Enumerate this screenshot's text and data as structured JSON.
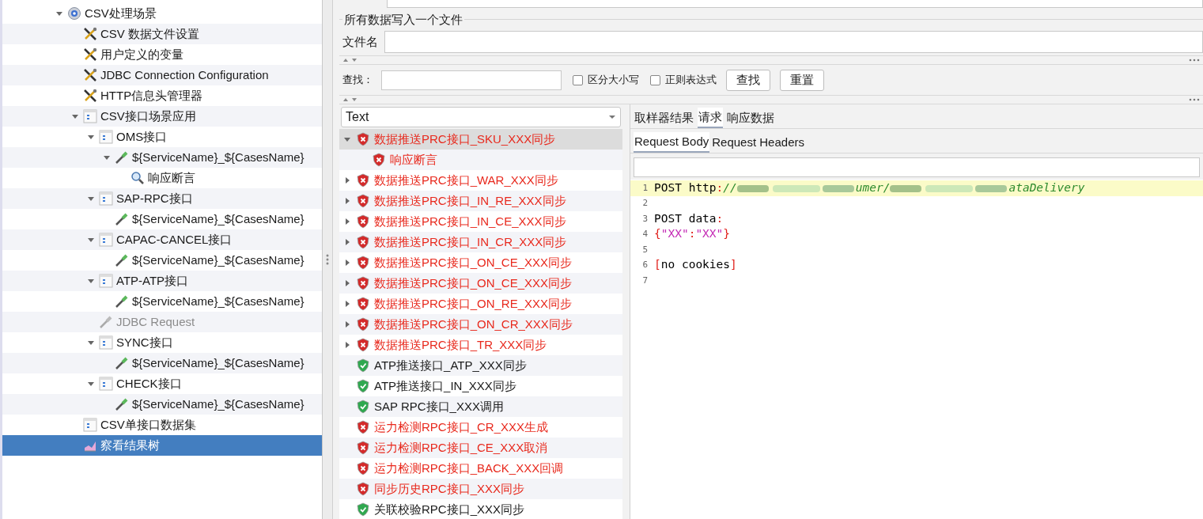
{
  "tree": [
    {
      "label": "CSV处理场景",
      "kind": "gear",
      "expanded": true,
      "selected": false,
      "disabled": false,
      "children": [
        {
          "label": "CSV 数据文件设置",
          "kind": "tool",
          "selected": false,
          "disabled": false
        },
        {
          "label": "用户定义的变量",
          "kind": "tool",
          "selected": false,
          "disabled": false
        },
        {
          "label": "JDBC Connection Configuration",
          "kind": "tool",
          "selected": false,
          "disabled": false
        },
        {
          "label": "HTTP信息头管理器",
          "kind": "tool",
          "selected": false,
          "disabled": false
        },
        {
          "label": "CSV接口场景应用",
          "kind": "controller",
          "expanded": true,
          "selected": false,
          "disabled": false,
          "children": [
            {
              "label": "OMS接口",
              "kind": "controller",
              "expanded": true,
              "selected": false,
              "disabled": false,
              "children": [
                {
                  "label": "${ServiceName}_${CasesName}",
                  "kind": "sampler",
                  "expanded": true,
                  "selected": false,
                  "disabled": false,
                  "children": [
                    {
                      "label": "响应断言",
                      "kind": "assertion",
                      "selected": false,
                      "disabled": false
                    }
                  ]
                }
              ]
            },
            {
              "label": "SAP-RPC接口",
              "kind": "controller",
              "expanded": true,
              "selected": false,
              "disabled": false,
              "children": [
                {
                  "label": "${ServiceName}_${CasesName}",
                  "kind": "sampler",
                  "selected": false,
                  "disabled": false
                }
              ]
            },
            {
              "label": "CAPAC-CANCEL接口",
              "kind": "controller",
              "expanded": true,
              "selected": false,
              "disabled": false,
              "children": [
                {
                  "label": "${ServiceName}_${CasesName}",
                  "kind": "sampler",
                  "selected": false,
                  "disabled": false
                }
              ]
            },
            {
              "label": "ATP-ATP接口",
              "kind": "controller",
              "expanded": true,
              "selected": false,
              "disabled": false,
              "children": [
                {
                  "label": "${ServiceName}_${CasesName}",
                  "kind": "sampler",
                  "selected": false,
                  "disabled": false
                }
              ]
            },
            {
              "label": "JDBC Request",
              "kind": "sampler",
              "selected": false,
              "disabled": true
            },
            {
              "label": "SYNC接口",
              "kind": "controller",
              "expanded": true,
              "selected": false,
              "disabled": false,
              "children": [
                {
                  "label": "${ServiceName}_${CasesName}",
                  "kind": "sampler",
                  "selected": false,
                  "disabled": false
                }
              ]
            },
            {
              "label": "CHECK接口",
              "kind": "controller",
              "expanded": true,
              "selected": false,
              "disabled": false,
              "children": [
                {
                  "label": "${ServiceName}_${CasesName}",
                  "kind": "sampler",
                  "selected": false,
                  "disabled": false
                }
              ]
            }
          ]
        },
        {
          "label": "CSV单接口数据集",
          "kind": "controller",
          "selected": false,
          "disabled": false
        },
        {
          "label": "察看结果树",
          "kind": "listener",
          "selected": true,
          "disabled": false
        }
      ]
    }
  ],
  "file_group": {
    "legend": "所有数据写入一个文件",
    "filename_label": "文件名"
  },
  "search": {
    "label": "查找：",
    "options": [
      {
        "label": "区分大小写",
        "checked": false
      },
      {
        "label": "正则表达式",
        "checked": false
      }
    ],
    "buttons": [
      "查找",
      "重置"
    ]
  },
  "renderer": {
    "value": "Text"
  },
  "results": [
    {
      "label": "数据推送PRC接口_SKU_XXX同步",
      "passed": false,
      "expanded": true,
      "selected": true,
      "children": [
        {
          "label": "响应断言",
          "passed": false,
          "selected": false
        }
      ]
    },
    {
      "label": "数据推送PRC接口_WAR_XXX同步",
      "passed": false,
      "expanded": false,
      "selected": false
    },
    {
      "label": "数据推送PRC接口_IN_RE_XXX同步",
      "passed": false,
      "expanded": false,
      "selected": false
    },
    {
      "label": "数据推送PRC接口_IN_CE_XXX同步",
      "passed": false,
      "expanded": false,
      "selected": false
    },
    {
      "label": "数据推送PRC接口_IN_CR_XXX同步",
      "passed": false,
      "expanded": false,
      "selected": false
    },
    {
      "label": "数据推送PRC接口_ON_CE_XXX同步",
      "passed": false,
      "expanded": false,
      "selected": false
    },
    {
      "label": "数据推送PRC接口_ON_CE_XXX同步",
      "passed": false,
      "expanded": false,
      "selected": false
    },
    {
      "label": "数据推送PRC接口_ON_RE_XXX同步",
      "passed": false,
      "expanded": false,
      "selected": false
    },
    {
      "label": "数据推送PRC接口_ON_CR_XXX同步",
      "passed": false,
      "expanded": false,
      "selected": false
    },
    {
      "label": "数据推送PRC接口_TR_XXX同步",
      "passed": false,
      "expanded": false,
      "selected": false
    },
    {
      "label": "ATP推送接口_ATP_XXX同步",
      "passed": true,
      "selected": false
    },
    {
      "label": "ATP推送接口_IN_XXX同步",
      "passed": true,
      "selected": false
    },
    {
      "label": "SAP RPC接口_XXX调用",
      "passed": true,
      "selected": false
    },
    {
      "label": "运力检测RPC接口_CR_XXX生成",
      "passed": false,
      "selected": false
    },
    {
      "label": "运力检测RPC接口_CE_XXX取消",
      "passed": false,
      "selected": false
    },
    {
      "label": "运力检测RPC接口_BACK_XXX回调",
      "passed": false,
      "selected": false
    },
    {
      "label": "同步历史RPC接口_XXX同步",
      "passed": false,
      "selected": false
    },
    {
      "label": "关联校验RPC接口_XXX同步",
      "passed": true,
      "selected": false
    }
  ],
  "tabs": [
    {
      "label": "取样器结果",
      "selected": false
    },
    {
      "label": "请求",
      "selected": true
    },
    {
      "label": "响应数据",
      "selected": false
    }
  ],
  "subtabs": [
    {
      "label": "Request Body",
      "selected": true
    },
    {
      "label": "Request Headers",
      "selected": false
    }
  ],
  "code": [
    {
      "number": "1",
      "highlighted": true,
      "tokens": [
        {
          "text": "POST http",
          "kind": "plain"
        },
        {
          "text": ":",
          "kind": "punct"
        },
        {
          "text": "//",
          "kind": "url"
        },
        {
          "kind": "blur"
        },
        {
          "text": "umer/",
          "kind": "url"
        },
        {
          "kind": "blur"
        },
        {
          "text": "ataDelivery",
          "kind": "url"
        }
      ]
    },
    {
      "number": "2",
      "highlighted": false
    },
    {
      "number": "3",
      "highlighted": false,
      "tokens": [
        {
          "text": "POST data",
          "kind": "plain"
        },
        {
          "text": ":",
          "kind": "punct"
        }
      ]
    },
    {
      "number": "4",
      "highlighted": false,
      "tokens": [
        {
          "text": "{",
          "kind": "punct"
        },
        {
          "text": "\"XX\"",
          "kind": "string"
        },
        {
          "text": ":",
          "kind": "punct"
        },
        {
          "text": "\"XX\"",
          "kind": "string"
        },
        {
          "text": "}",
          "kind": "punct"
        }
      ]
    },
    {
      "number": "5",
      "highlighted": false
    },
    {
      "number": "6",
      "highlighted": false,
      "tokens": [
        {
          "text": "[",
          "kind": "punct"
        },
        {
          "text": "no cookies",
          "kind": "plain"
        },
        {
          "text": "]",
          "kind": "punct"
        }
      ]
    },
    {
      "number": "7",
      "highlighted": false
    }
  ]
}
